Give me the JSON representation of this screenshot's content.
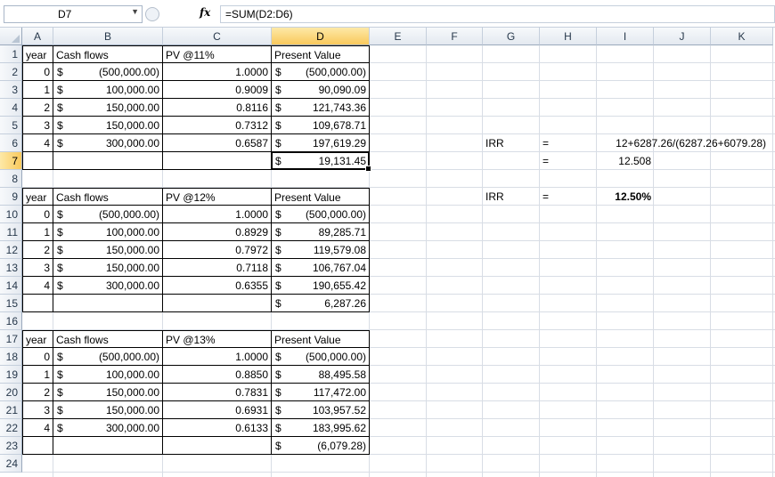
{
  "formula_bar": {
    "name_box": "D7",
    "fx_label": "fx",
    "formula": "=SUM(D2:D6)"
  },
  "columns": [
    "A",
    "B",
    "C",
    "D",
    "E",
    "F",
    "G",
    "H",
    "I",
    "J",
    "K"
  ],
  "rows": [
    "1",
    "2",
    "3",
    "4",
    "5",
    "6",
    "7",
    "8",
    "9",
    "10",
    "11",
    "12",
    "13",
    "14",
    "15",
    "16",
    "17",
    "18",
    "19",
    "20",
    "21",
    "22",
    "23",
    "24"
  ],
  "active_cell": {
    "column": "D",
    "row": "7"
  },
  "tables": [
    {
      "header": {
        "year": "year",
        "cash": "Cash flows",
        "pv": "PV @11%",
        "present": "Present Value"
      },
      "rows": [
        {
          "year": "0",
          "cash_sym": "$",
          "cash": "(500,000.00)",
          "pv": "1.0000",
          "pres_sym": "$",
          "present": "(500,000.00)"
        },
        {
          "year": "1",
          "cash_sym": "$",
          "cash": "100,000.00",
          "pv": "0.9009",
          "pres_sym": "$",
          "present": "90,090.09"
        },
        {
          "year": "2",
          "cash_sym": "$",
          "cash": "150,000.00",
          "pv": "0.8116",
          "pres_sym": "$",
          "present": "121,743.36"
        },
        {
          "year": "3",
          "cash_sym": "$",
          "cash": "150,000.00",
          "pv": "0.7312",
          "pres_sym": "$",
          "present": "109,678.71"
        },
        {
          "year": "4",
          "cash_sym": "$",
          "cash": "300,000.00",
          "pv": "0.6587",
          "pres_sym": "$",
          "present": "197,619.29"
        }
      ],
      "total": {
        "sym": "$",
        "value": "19,131.45"
      }
    },
    {
      "header": {
        "year": "year",
        "cash": "Cash flows",
        "pv": "PV @12%",
        "present": "Present Value"
      },
      "rows": [
        {
          "year": "0",
          "cash_sym": "$",
          "cash": "(500,000.00)",
          "pv": "1.0000",
          "pres_sym": "$",
          "present": "(500,000.00)"
        },
        {
          "year": "1",
          "cash_sym": "$",
          "cash": "100,000.00",
          "pv": "0.8929",
          "pres_sym": "$",
          "present": "89,285.71"
        },
        {
          "year": "2",
          "cash_sym": "$",
          "cash": "150,000.00",
          "pv": "0.7972",
          "pres_sym": "$",
          "present": "119,579.08"
        },
        {
          "year": "3",
          "cash_sym": "$",
          "cash": "150,000.00",
          "pv": "0.7118",
          "pres_sym": "$",
          "present": "106,767.04"
        },
        {
          "year": "4",
          "cash_sym": "$",
          "cash": "300,000.00",
          "pv": "0.6355",
          "pres_sym": "$",
          "present": "190,655.42"
        }
      ],
      "total": {
        "sym": "$",
        "value": "6,287.26"
      }
    },
    {
      "header": {
        "year": "year",
        "cash": "Cash flows",
        "pv": "PV @13%",
        "present": "Present Value"
      },
      "rows": [
        {
          "year": "0",
          "cash_sym": "$",
          "cash": "(500,000.00)",
          "pv": "1.0000",
          "pres_sym": "$",
          "present": "(500,000.00)"
        },
        {
          "year": "1",
          "cash_sym": "$",
          "cash": "100,000.00",
          "pv": "0.8850",
          "pres_sym": "$",
          "present": "88,495.58"
        },
        {
          "year": "2",
          "cash_sym": "$",
          "cash": "150,000.00",
          "pv": "0.7831",
          "pres_sym": "$",
          "present": "117,472.00"
        },
        {
          "year": "3",
          "cash_sym": "$",
          "cash": "150,000.00",
          "pv": "0.6931",
          "pres_sym": "$",
          "present": "103,957.52"
        },
        {
          "year": "4",
          "cash_sym": "$",
          "cash": "300,000.00",
          "pv": "0.6133",
          "pres_sym": "$",
          "present": "183,995.62"
        }
      ],
      "total": {
        "sym": "$",
        "value": "(6,079.28)"
      }
    }
  ],
  "irr": {
    "label1": "IRR",
    "eq1": "=",
    "formula_text": "12+6287.26/(6287.26+6079.28)",
    "eq2": "=",
    "result": "12.508",
    "label2": "IRR",
    "eq3": "=",
    "final": "12.50%"
  },
  "colors": {
    "header_bg": "#e4e9f0",
    "active_header": "#f9c95c",
    "gridline": "#d8dde5"
  }
}
